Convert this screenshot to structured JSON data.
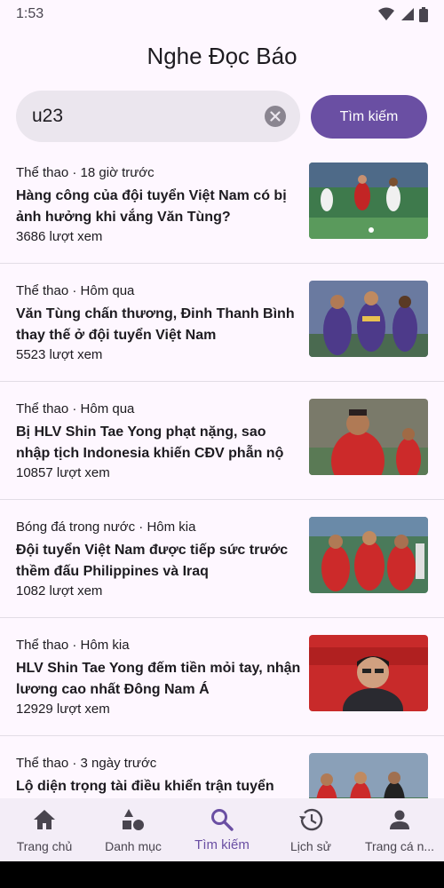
{
  "status_bar": {
    "time": "1:53",
    "icons": [
      "wifi-icon",
      "signal-icon",
      "battery-icon"
    ]
  },
  "app": {
    "title": "Nghe Đọc Báo"
  },
  "search": {
    "value": "u23",
    "button_label": "Tìm kiếm"
  },
  "articles": [
    {
      "meta": "Thể thao · 18 giờ trước",
      "title": "Hàng công của đội tuyển Việt Nam có bị ảnh hưởng khi vắng Văn Tùng?",
      "views": "3686 lượt xem",
      "thumb": "football-match-photo"
    },
    {
      "meta": "Thể thao · Hôm qua",
      "title": "Văn Tùng chấn thương, Đinh Thanh Bình thay thế ở đội tuyển Việt Nam",
      "views": "5523 lượt xem",
      "thumb": "players-celebrating-photo"
    },
    {
      "meta": "Thể thao · Hôm qua",
      "title": "Bị HLV Shin Tae Yong phạt nặng, sao nhập tịch Indonesia khiến CĐV phẫn nộ",
      "views": "10857 lượt xem",
      "thumb": "indonesia-player-photo"
    },
    {
      "meta": "Bóng đá trong nước · Hôm kia",
      "title": "Đội tuyển Việt Nam được tiếp sức trước thềm đấu Philippines và Iraq",
      "views": "1082 lượt xem",
      "thumb": "vietnam-team-photo"
    },
    {
      "meta": "Thể thao · Hôm kia",
      "title": "HLV Shin Tae Yong đếm tiền mỏi tay, nhận lương cao nhất Đông Nam Á",
      "views": "12929 lượt xem",
      "thumb": "coach-portrait-photo"
    },
    {
      "meta": "Thể thao · 3 ngày trước",
      "title": "Lộ diện trọng tài điều khiển trận tuyển Việt Nam - Philippines",
      "views": "",
      "thumb": "referee-match-photo"
    }
  ],
  "bottom_nav": [
    {
      "label": "Trang chủ",
      "icon": "home-icon",
      "active": false
    },
    {
      "label": "Danh mục",
      "icon": "category-icon",
      "active": false
    },
    {
      "label": "Tìm kiếm",
      "icon": "search-icon",
      "active": true
    },
    {
      "label": "Lịch sử",
      "icon": "history-icon",
      "active": false
    },
    {
      "label": "Trang cá n...",
      "icon": "person-icon",
      "active": false
    }
  ],
  "colors": {
    "accent": "#6a4fa3",
    "background": "#fef7ff",
    "nav_background": "#f3edf7"
  }
}
